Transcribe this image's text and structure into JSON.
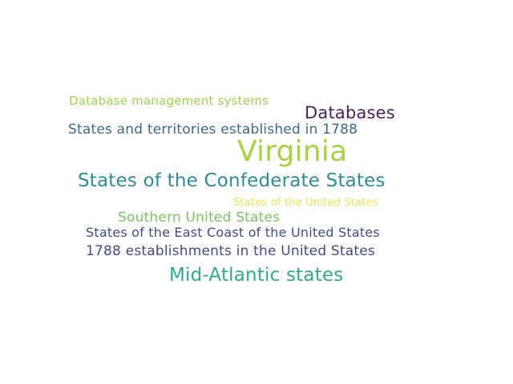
{
  "word_cloud": {
    "words": [
      {
        "text": "Database management systems",
        "color": "#9fd44a"
      },
      {
        "text": "Databases",
        "color": "#4b1d63"
      },
      {
        "text": "States and territories established in 1788",
        "color": "#3a6b8f"
      },
      {
        "text": "Virginia",
        "color": "#a6d33f"
      },
      {
        "text": "States of the Confederate States",
        "color": "#2e8c9a"
      },
      {
        "text": "States of the United States",
        "color": "#f0e04a"
      },
      {
        "text": "Southern United States",
        "color": "#76c85a"
      },
      {
        "text": "States of the East Coast of the United States",
        "color": "#3f4e88"
      },
      {
        "text": "1788 establishments in the United States",
        "color": "#414a86"
      },
      {
        "text": "Mid-Atlantic states",
        "color": "#2fa98e"
      }
    ]
  }
}
